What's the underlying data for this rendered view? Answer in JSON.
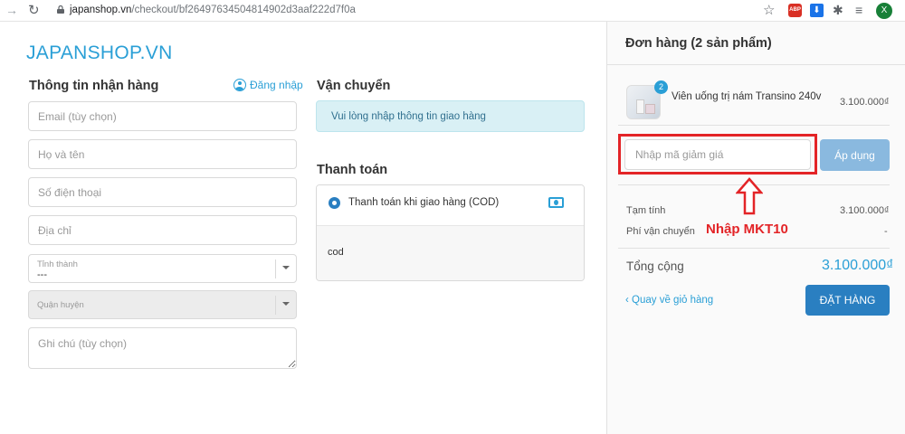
{
  "browser": {
    "url_host": "japanshop.vn",
    "url_path": "/checkout/bf26497634504814902d3aaf222d7f0a",
    "adblock_label": "ABP",
    "profile_initial": "X"
  },
  "site": {
    "logo": "JAPANSHOP.VN"
  },
  "recipient": {
    "heading": "Thông tin nhận hàng",
    "login_label": "Đăng nhập",
    "email_placeholder": "Email (tùy chọn)",
    "name_placeholder": "Họ và tên",
    "phone_placeholder": "Số điện thoại",
    "address_placeholder": "Địa chỉ",
    "province_label": "Tỉnh thành",
    "province_value": "---",
    "district_label": "Quận huyện",
    "note_placeholder": "Ghi chú (tùy chọn)"
  },
  "shipping": {
    "heading": "Vận chuyển",
    "alert": "Vui lòng nhập thông tin giao hàng"
  },
  "payment": {
    "heading": "Thanh toán",
    "option_label": "Thanh toán khi giao hàng (COD)",
    "option_body": "cod"
  },
  "order": {
    "title": "Đơn hàng (2 sản phẩm)",
    "item": {
      "name": "Viên uống trị nám Transino 240v",
      "price": "3.100.000₫",
      "quantity": "2"
    },
    "coupon_placeholder": "Nhập mã giảm giá",
    "apply_label": "Áp dụng",
    "subtotal_label": "Tạm tính",
    "subtotal_value": "3.100.000₫",
    "shipping_fee_label": "Phí vận chuyển",
    "shipping_fee_value": "-",
    "total_label": "Tổng cộng",
    "total_value": "3.100.000₫",
    "back_label": "Quay về giỏ hàng",
    "checkout_label": "ĐẶT HÀNG"
  },
  "annotation": {
    "text": "Nhập MKT10",
    "color": "#e32427"
  },
  "colors": {
    "accent": "#2a9fd6",
    "button": "#2a7fc1",
    "apply_button": "#8ab9df"
  }
}
